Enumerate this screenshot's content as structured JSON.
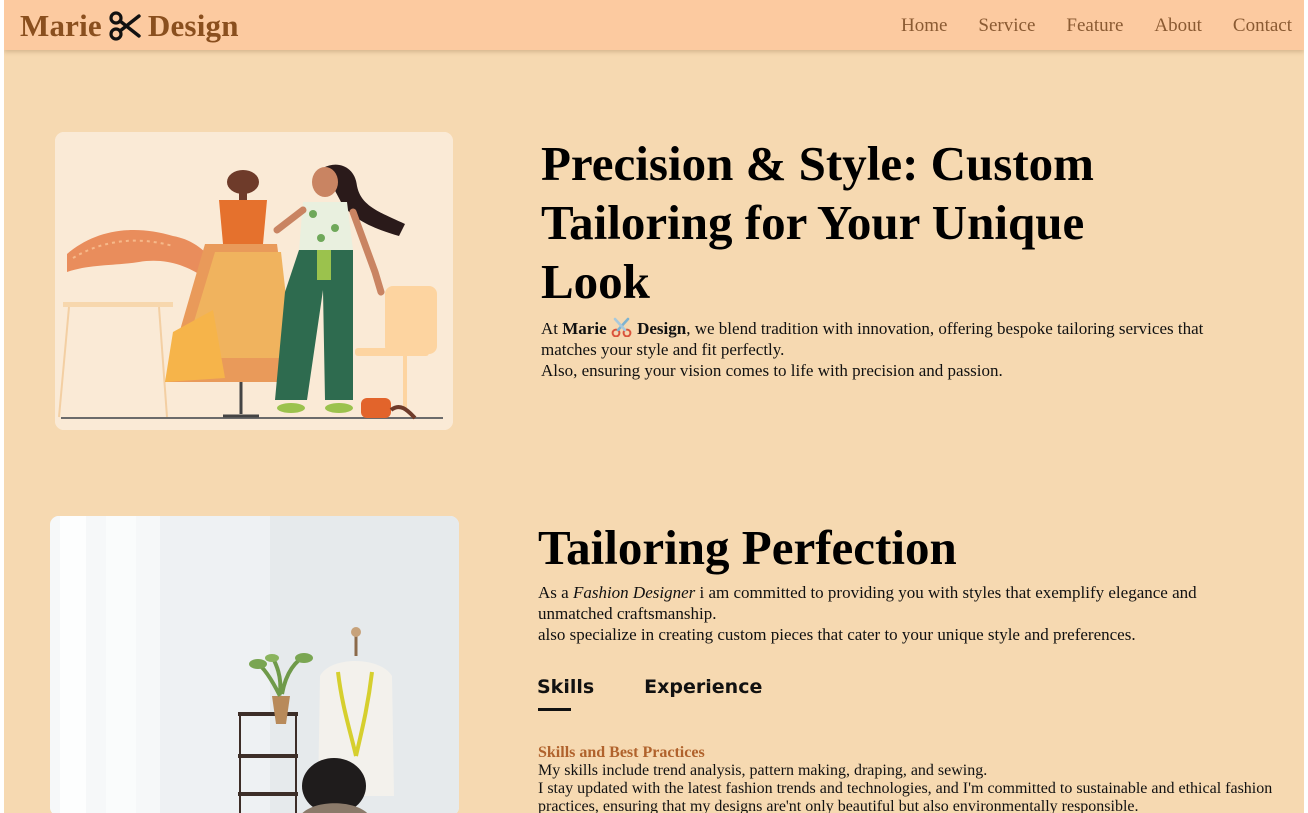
{
  "navbar": {
    "brand_left": "Marie",
    "brand_right": "Design",
    "brand_icon": "scissors-icon",
    "links": [
      "Home",
      "Service",
      "Feature",
      "About",
      "Contact"
    ]
  },
  "hero": {
    "title": "Precision & Style: Custom Tailoring for Your Unique Look",
    "text_intro": "At ",
    "brand_left": "Marie",
    "brand_right": "Design",
    "text_rest": ", we blend tradition with innovation, offering bespoke tailoring services that matches your style and fit perfectly.",
    "text_line2": "Also, ensuring your vision comes to life with precision and passion."
  },
  "about": {
    "title": "Tailoring Perfection",
    "text_intro": "As a ",
    "text_em": "Fashion Designer",
    "text_rest": " i am committed to providing you with styles that exemplify elegance and unmatched craftsmanship.",
    "text_line2": "also specialize in creating custom pieces that cater to your unique style and preferences.",
    "tabs": [
      "Skills",
      "Experience"
    ],
    "active_tab": "Skills",
    "skills_heading": "Skills and Best Practices",
    "skills_line1": "My skills include trend analysis, pattern making, draping, and sewing.",
    "skills_line2": "I stay updated with the latest fashion trends and technologies, and I'm committed to sustainable and ethical fashion practices, ensuring that my designs are'nt only beautiful but also environmentally responsible."
  },
  "colors": {
    "background": "#f6d9b1",
    "navbar": "#fccaa0",
    "brand": "#8a4f1e",
    "accent_heading": "#b0622c"
  }
}
